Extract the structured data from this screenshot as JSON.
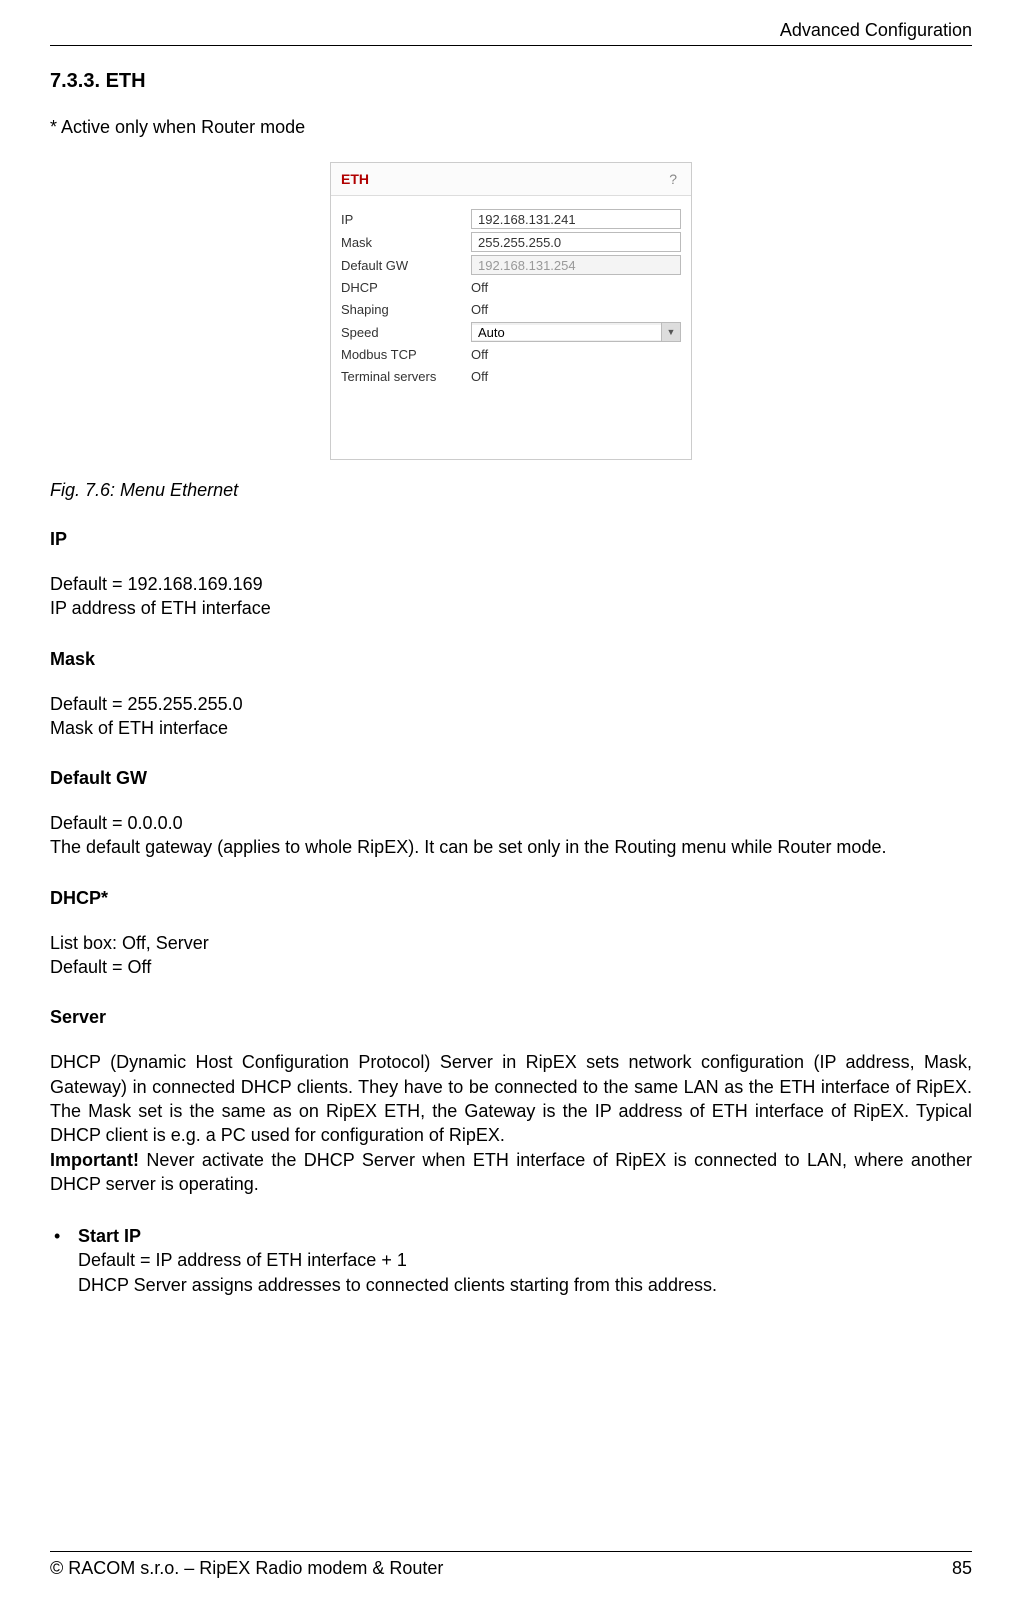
{
  "header": {
    "right_title": "Advanced Configuration"
  },
  "section": {
    "heading": "7.3.3. ETH",
    "note": "* Active only when Router mode"
  },
  "eth_panel": {
    "title": "ETH",
    "help": "?",
    "rows": {
      "ip": {
        "label": "IP",
        "value": "192.168.131.241",
        "type": "input"
      },
      "mask": {
        "label": "Mask",
        "value": "255.255.255.0",
        "type": "input"
      },
      "default_gw": {
        "label": "Default GW",
        "value": "192.168.131.254",
        "type": "input_disabled"
      },
      "dhcp": {
        "label": "DHCP",
        "value": "Off",
        "type": "text"
      },
      "shaping": {
        "label": "Shaping",
        "value": "Off",
        "type": "text"
      },
      "speed": {
        "label": "Speed",
        "value": "Auto",
        "type": "select"
      },
      "modbus": {
        "label": "Modbus TCP",
        "value": "Off",
        "type": "text"
      },
      "terminal": {
        "label": "Terminal servers",
        "value": "Off",
        "type": "text"
      }
    }
  },
  "fig_caption": "Fig. 7.6: Menu Ethernet",
  "fields": {
    "ip": {
      "heading": "IP",
      "body": "Default = 192.168.169.169\nIP address of ETH interface"
    },
    "mask": {
      "heading": "Mask",
      "body": "Default = 255.255.255.0\nMask of ETH interface"
    },
    "default_gw": {
      "heading": "Default GW",
      "body": "Default = 0.0.0.0\nThe default gateway (applies to whole RipEX). It can be set only in the Routing menu while Router mode."
    },
    "dhcp": {
      "heading": "DHCP*",
      "body": "List box: Off, Server\nDefault = Off"
    },
    "server": {
      "heading": "Server",
      "body": "DHCP (Dynamic Host Configuration Protocol) Server in RipEX sets network configuration (IP address, Mask, Gateway) in connected DHCP clients. They have to be connected to the same LAN as the ETH interface of RipEX. The Mask set is the same as on RipEX ETH, the Gateway is the IP address of ETH interface of RipEX. Typical DHCP client is e.g. a PC used for configuration of RipEX.",
      "important_label": "Important!",
      "important_text": " Never activate the DHCP Server when ETH interface of RipEX is connected to LAN, where another DHCP server is operating."
    },
    "start_ip": {
      "heading": "Start IP",
      "body": "Default = IP address of ETH interface + 1\nDHCP Server assigns addresses to connected clients starting from this address."
    }
  },
  "footer": {
    "left": "© RACOM s.r.o. – RipEX Radio modem & Router",
    "right": "85"
  }
}
